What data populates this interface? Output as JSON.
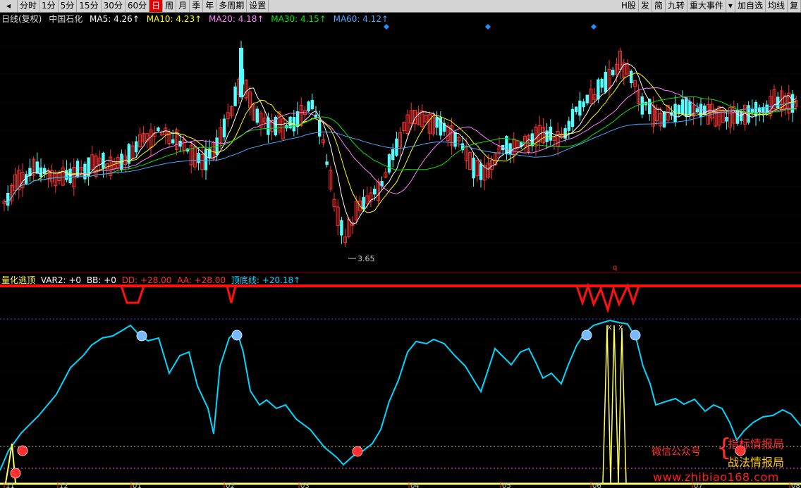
{
  "toolbar": {
    "left": [
      "分时",
      "1分",
      "5分",
      "15分",
      "30分",
      "60分",
      "日",
      "周",
      "月",
      "季",
      "年",
      "多周期",
      "设置"
    ],
    "active": "日",
    "right": [
      "H股",
      "发",
      "简",
      "九转",
      "重大事件",
      "加自选",
      "均线",
      "复"
    ]
  },
  "main_info": {
    "label": "日线(复权)",
    "name": "中国石化",
    "ma5": "MA5: 4.26↑",
    "ma10": "MA10: 4.23↑",
    "ma20": "MA20: 4.18↑",
    "ma30": "MA30: 4.15↑",
    "ma60": "MA60: 4.12↑"
  },
  "sub_info": {
    "label": "量化逃顶",
    "var2": "VAR2: +0",
    "bb": "BB: +0",
    "dd": "DD: +28.00",
    "aa": "AA: +28.00",
    "dingdi": "顶底线: +20.18↑"
  },
  "price_low_label": "3.65",
  "marker_q": "q",
  "x_labels": [
    "11",
    "12",
    "01",
    "02",
    "03",
    "04",
    "05",
    "06",
    "07",
    "08"
  ],
  "watermark": {
    "left": "微信公众号",
    "right1": "指标情报局",
    "right2": "战法情报局",
    "url": "www.zhibiao168.com"
  },
  "colors": {
    "up": "#ff3232",
    "down": "#54ffff",
    "ma5": "#ffffff",
    "ma10": "#ffff00",
    "ma20": "#ff80ff",
    "ma30": "#00e600",
    "ma60": "#4da6ff",
    "dingdi": "#00d7ff",
    "signal": "#ffff60"
  }
}
